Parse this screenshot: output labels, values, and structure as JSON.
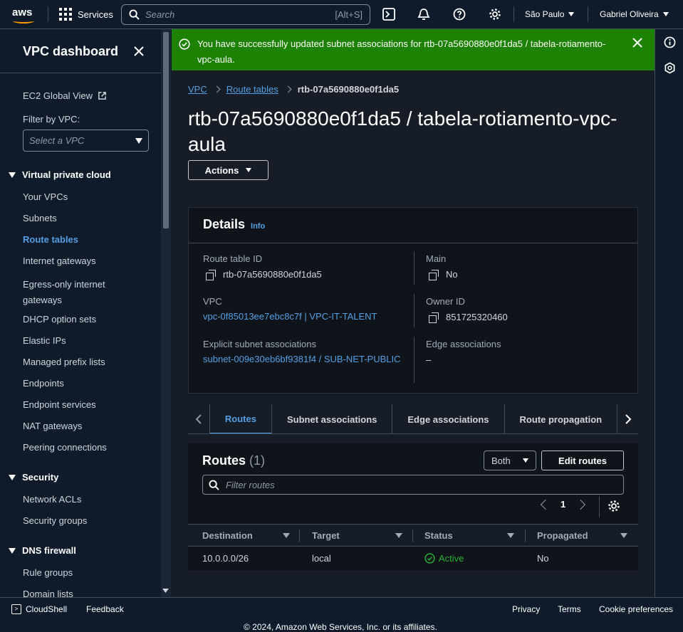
{
  "topbar": {
    "logo": "aws",
    "services": "Services",
    "search_placeholder": "Search",
    "search_shortcut": "[Alt+S]",
    "region": "São Paulo",
    "user": "Gabriel Oliveira"
  },
  "sidebar": {
    "title": "VPC dashboard",
    "global_view": "EC2 Global View",
    "filter_label": "Filter by VPC:",
    "filter_placeholder": "Select a VPC",
    "sections": [
      {
        "label": "Virtual private cloud",
        "items": [
          "Your VPCs",
          "Subnets",
          "Route tables",
          "Internet gateways",
          "Egress-only internet gateways",
          "DHCP option sets",
          "Elastic IPs",
          "Managed prefix lists",
          "Endpoints",
          "Endpoint services",
          "NAT gateways",
          "Peering connections"
        ]
      },
      {
        "label": "Security",
        "items": [
          "Network ACLs",
          "Security groups"
        ]
      },
      {
        "label": "DNS firewall",
        "items": [
          "Rule groups",
          "Domain lists"
        ]
      }
    ],
    "active_item": "Route tables"
  },
  "flash": {
    "message": "You have successfully updated subnet associations for rtb-07a5690880e0f1da5 / tabela-rotiamento-vpc-aula.",
    "color": "#1d8102"
  },
  "breadcrumb": [
    "VPC",
    "Route tables",
    "rtb-07a5690880e0f1da5"
  ],
  "page_title": "rtb-07a5690880e0f1da5 / tabela-rotiamento-vpc-aula",
  "actions_label": "Actions",
  "details": {
    "title": "Details",
    "info": "Info",
    "route_table_id_label": "Route table ID",
    "route_table_id": "rtb-07a5690880e0f1da5",
    "main_label": "Main",
    "main": "No",
    "vpc_label": "VPC",
    "vpc": "vpc-0f85013ee7ebc8c7f | VPC-IT-TALENT",
    "owner_label": "Owner ID",
    "owner": "851725320460",
    "explicit_label": "Explicit subnet associations",
    "explicit": "subnet-009e30eb6bf9381f4 / SUB-NET-PUBLIC",
    "edge_label": "Edge associations",
    "edge": "–"
  },
  "tabs": [
    "Routes",
    "Subnet associations",
    "Edge associations",
    "Route propagation"
  ],
  "active_tab": "Routes",
  "routes": {
    "title": "Routes",
    "count": "(1)",
    "filter_select": "Both",
    "edit_label": "Edit routes",
    "filter_placeholder": "Filter routes",
    "page": "1",
    "columns": [
      "Destination",
      "Target",
      "Status",
      "Propagated"
    ],
    "rows": [
      {
        "destination": "10.0.0.0/26",
        "target": "local",
        "status": "Active",
        "propagated": "No"
      }
    ]
  },
  "footer": {
    "cloudshell": "CloudShell",
    "feedback": "Feedback",
    "privacy": "Privacy",
    "terms": "Terms",
    "cookies": "Cookie preferences",
    "copyright": "© 2024, Amazon Web Services, Inc. or its affiliates."
  },
  "colors": {
    "accent": "#539fe5",
    "success": "#1d8102",
    "status_active": "#29ad32",
    "brand": "#ff9900"
  }
}
